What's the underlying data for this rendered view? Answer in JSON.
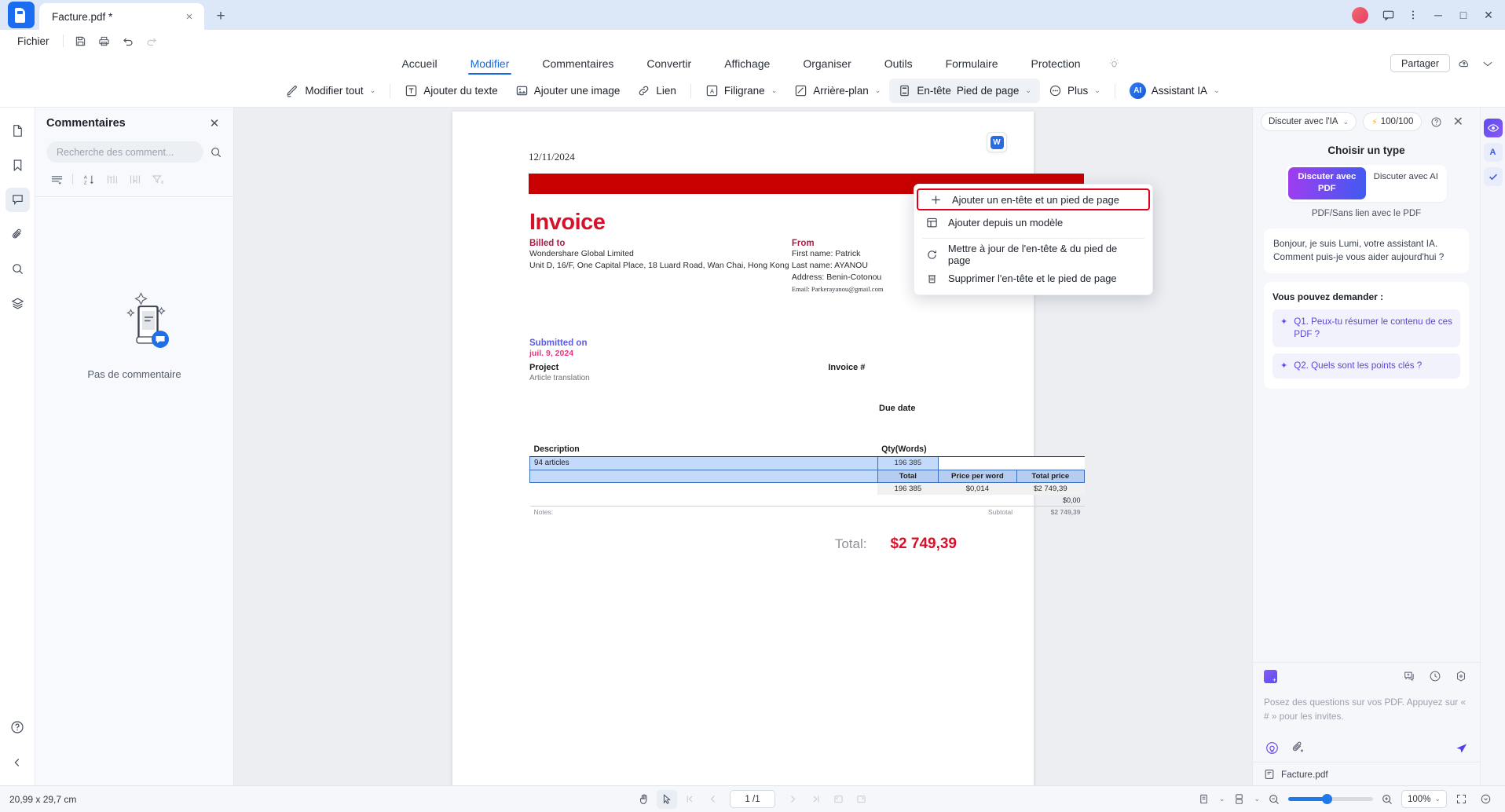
{
  "titlebar": {
    "tab_title": "Facture.pdf *",
    "close_tab": "×",
    "new_tab": "+",
    "minimize": "─",
    "maximize": "□",
    "close_window": "✕"
  },
  "menubar": {
    "fichier": "Fichier",
    "icons": [
      "save-icon",
      "print-icon",
      "undo-icon",
      "redo-icon"
    ]
  },
  "ribbon": {
    "tabs": [
      {
        "label": "Accueil",
        "active": false
      },
      {
        "label": "Modifier",
        "active": true
      },
      {
        "label": "Commentaires",
        "active": false
      },
      {
        "label": "Convertir",
        "active": false
      },
      {
        "label": "Affichage",
        "active": false
      },
      {
        "label": "Organiser",
        "active": false
      },
      {
        "label": "Outils",
        "active": false
      },
      {
        "label": "Formulaire",
        "active": false
      },
      {
        "label": "Protection",
        "active": false
      }
    ],
    "share_label": "Partager"
  },
  "toolstrip": {
    "modifier_tout": "Modifier tout",
    "ajouter_texte": "Ajouter du texte",
    "ajouter_image": "Ajouter une image",
    "lien": "Lien",
    "filigrane": "Filigrane",
    "arriere_plan": "Arrière-plan",
    "entete": "En-tête",
    "pied_de_page": "Pied de page",
    "plus": "Plus",
    "assistant_ia": "Assistant IA",
    "ai_badge": "AI",
    "caret": "⌄"
  },
  "dropdown": {
    "items": [
      {
        "label": "Ajouter un en-tête et un pied de page",
        "icon": "plus-icon",
        "highlighted": true
      },
      {
        "label": "Ajouter depuis un modèle",
        "icon": "template-icon",
        "highlighted": false
      },
      {
        "label": "Mettre à jour de l'en-tête & du pied de page",
        "icon": "refresh-icon",
        "highlighted": false
      },
      {
        "label": "Supprimer l'en-tête et le pied de page",
        "icon": "trash-icon",
        "highlighted": false
      }
    ]
  },
  "rail": {
    "items": [
      {
        "name": "page-thumbnails-icon",
        "active": false
      },
      {
        "name": "bookmark-icon",
        "active": false
      },
      {
        "name": "comment-icon",
        "active": true
      },
      {
        "name": "attachment-icon",
        "active": false
      },
      {
        "name": "search-icon",
        "active": false
      },
      {
        "name": "layers-icon",
        "active": false
      }
    ],
    "bottom": [
      {
        "name": "help-icon"
      },
      {
        "name": "collapse-left-icon"
      }
    ]
  },
  "comments": {
    "title": "Commentaires",
    "close": "✕",
    "search_placeholder": "Recherche des comment...",
    "filter_icons": [
      "list-view-icon",
      "sort-az-icon",
      "sort-asc-icon",
      "sort-desc-icon",
      "filter-icon"
    ],
    "empty_text": "Pas de commentaire"
  },
  "document": {
    "date": "12/11/2024",
    "title": "Invoice",
    "billed_to_label": "Billed to",
    "billed_to_company": "Wondershare Global Limited",
    "billed_to_address": "Unit D, 16/F, One Capital Place, 18 Luard Road, Wan Chai, Hong Kong",
    "from_label": "From",
    "from_first": "First name: Patrick",
    "from_last": "Last name: AYANOU",
    "from_address": "Address: Benin-Cotonou",
    "from_email": "Email: Parkerayanou@gmail.com",
    "submitted_label": "Submitted on",
    "submitted_date": "juil. 9, 2024",
    "project_label": "Project",
    "project_value": "Article translation",
    "invoice_num_label": "Invoice #",
    "due_date_label": "Due date",
    "table": {
      "col_description": "Description",
      "col_qty": "Qty(Words)",
      "row_description": "94 articles",
      "row_qty": "196 385",
      "sub_total_hdr": "Total",
      "sub_price_hdr": "Price per word",
      "sub_totalprice_hdr": "Total price",
      "val_total": "196 385",
      "val_price": "$0,014",
      "val_totalprice": "$2 749,39",
      "zero_value": "$0,00",
      "notes_label": "Notes:",
      "subtotal_label": "Subtotal",
      "subtotal_value": "$2 749,39"
    },
    "total_label": "Total:",
    "total_value": "$2 749,39",
    "w_badge": "W"
  },
  "aipanel": {
    "select_label": "Discuter avec l'IA",
    "credits": "100/100",
    "credits_icon": "lightning-icon",
    "help_icon": "question-circle-icon",
    "close_icon": "✕",
    "choose_title": "Choisir un type",
    "seg_pdf": "Discuter avec PDF",
    "seg_ai": "Discuter avec AI",
    "seg_subtitle": "PDF/Sans lien avec le PDF",
    "greeting": "Bonjour, je suis Lumi, votre assistant IA. Comment puis-je vous aider aujourd'hui ?",
    "ask_title": "Vous pouvez demander :",
    "suggestions": [
      "Q1. Peux-tu résumer le contenu de ces PDF ?",
      "Q2. Quels sont les points clés ?"
    ],
    "composer_placeholder": "Posez des questions sur vos PDF. Appuyez sur « # » pour les invites.",
    "file_name": "Facture.pdf",
    "composer_icons": [
      "new-chat-icon",
      "history-icon",
      "settings-icon"
    ],
    "bottom_icons": [
      "prompt-bulb-icon",
      "attach-file-icon",
      "send-icon"
    ]
  },
  "floatcol": {
    "items": [
      {
        "name": "ai-eye-icon"
      },
      {
        "name": "ai-translate-icon"
      },
      {
        "name": "ai-check-icon"
      }
    ]
  },
  "statusbar": {
    "dimensions": "20,99 x 29,7 cm",
    "page_current": "1 /1",
    "zoom_level": "100%",
    "center_icons": [
      "hand-tool-icon",
      "select-tool-icon",
      "first-page-icon",
      "prev-page-icon",
      "next-page-icon",
      "last-page-icon",
      "rotate-left-icon",
      "rotate-right-icon"
    ],
    "right_icons": [
      "single-page-view-icon",
      "continuous-view-icon",
      "zoom-out-icon",
      "zoom-in-icon",
      "fit-page-icon",
      "more-view-icon"
    ]
  }
}
